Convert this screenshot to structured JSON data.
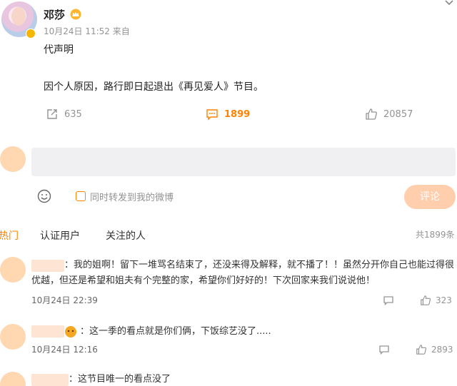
{
  "post": {
    "username": "邓莎",
    "meta": "10月24日 11:52  来自",
    "line1": "代声明",
    "line2": "因个人原因，路行即日起退出《再见爱人》节目。",
    "share_count": "635",
    "comment_count": "1899",
    "like_count": "20857"
  },
  "compose": {
    "forward_label": "同时转发到我的微博",
    "submit_label": "评论"
  },
  "tabs": {
    "hot": "热门",
    "verified": "认证用户",
    "follow": "关注的人",
    "total": "共1899条"
  },
  "comments": [
    {
      "text_line1": "：我的姐啊！留下一堆骂名结束了，还没来得及解释，就不播了！！虽然分开你自己也能过得很",
      "text_line2": "优越，但还是希望和姐夫有个完整的家，希望你们好好的！下次回家来我们说说他！",
      "time": "10月24日 22:39",
      "likes": "323"
    },
    {
      "text_line1": "：这一季的看点就是你们俩，下饭综艺没了.....",
      "time": "10月24日 12:16",
      "likes": "2893"
    },
    {
      "text_line1": "：这节目唯一的看点没了"
    }
  ],
  "colors": {
    "accent": "#ff8200",
    "muted": "#939393",
    "button_bg": "#ffcfad"
  },
  "icons": [
    "crown-icon",
    "share-icon",
    "comment-icon",
    "like-icon",
    "emoji-icon",
    "chevron-down-icon",
    "reply-icon"
  ]
}
